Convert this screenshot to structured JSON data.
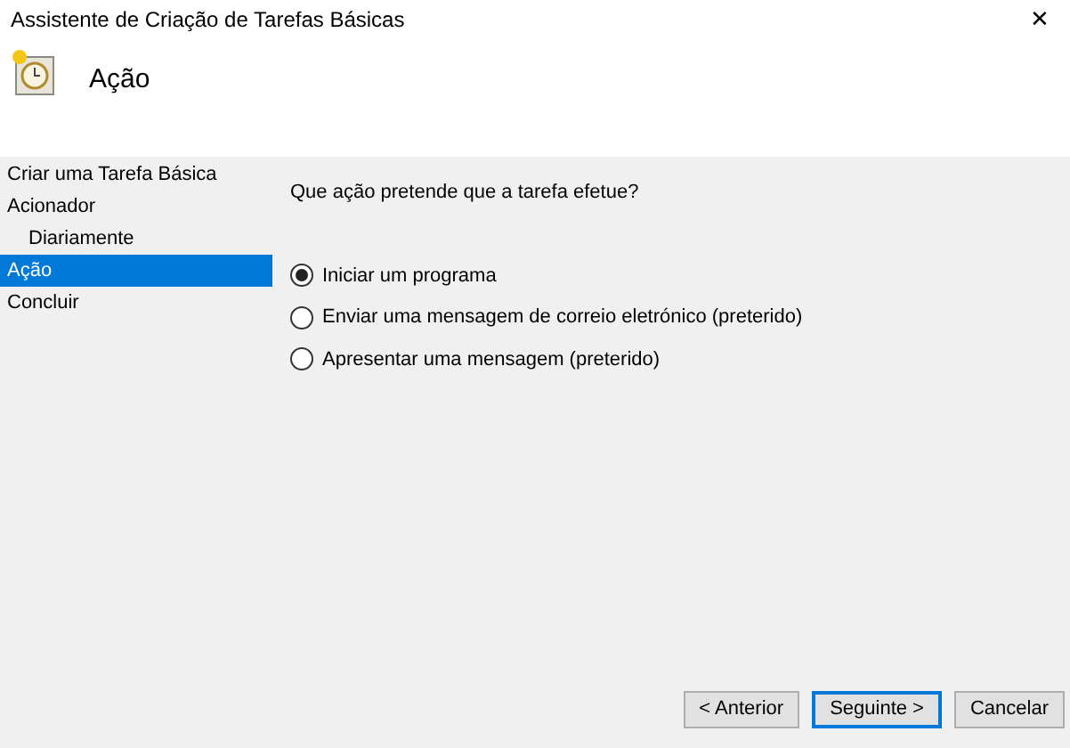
{
  "window": {
    "title": "Assistente de Criação de Tarefas Básicas",
    "close": "✕"
  },
  "header": {
    "title": "Ação"
  },
  "steps": [
    {
      "label": "Criar uma Tarefa Básica",
      "selected": false
    },
    {
      "label": "Acionador",
      "selected": false,
      "children": [
        {
          "label": "Diariamente",
          "selected": false
        }
      ]
    },
    {
      "label": "Ação",
      "selected": true
    },
    {
      "label": "Concluir",
      "selected": false
    }
  ],
  "question": "Que ação pretende que a tarefa efetue?",
  "options": [
    {
      "label": "Iniciar um programa",
      "selected": true
    },
    {
      "label": "Enviar uma mensagem de correio eletrónico (preterido)",
      "selected": false
    },
    {
      "label": "Apresentar uma mensagem (preterido)",
      "selected": false
    }
  ],
  "buttons": [
    {
      "label": "< Anterior",
      "focused": false
    },
    {
      "label": "Seguinte >",
      "focused": true
    },
    {
      "label": "Cancelar",
      "focused": false
    }
  ]
}
